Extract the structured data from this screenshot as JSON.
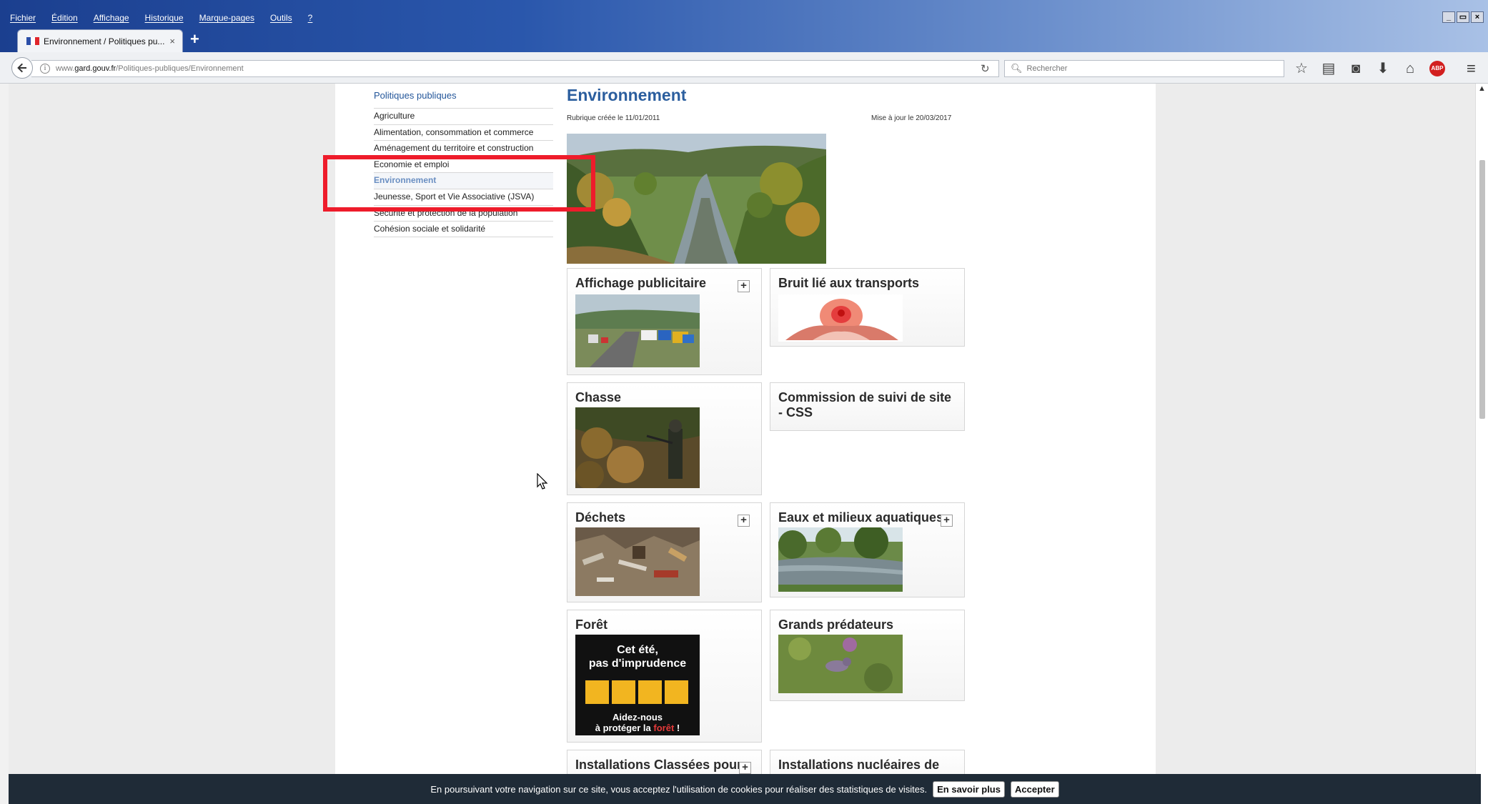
{
  "browser": {
    "menu": [
      "Fichier",
      "Édition",
      "Affichage",
      "Historique",
      "Marque-pages",
      "Outils",
      "?"
    ],
    "tab_title": "Environnement / Politiques pu...",
    "tab_close": "×",
    "new_tab": "+",
    "url_prefix": "www.",
    "url_domain": "gard.gouv.fr",
    "url_path": "/Politiques-publiques/Environnement",
    "search_placeholder": "Rechercher",
    "window_controls": [
      "_",
      "̅̅",
      "×"
    ]
  },
  "sidebar": {
    "heading": "Politiques publiques",
    "items": [
      "Agriculture",
      "Alimentation, consommation et commerce",
      "Aménagement du territoire et construction",
      "Economie et emploi",
      "Environnement",
      "Jeunesse, Sport et Vie Associative (JSVA)",
      "Sécurité et protection de la population",
      "Cohésion sociale et solidarité"
    ],
    "active_index": 4
  },
  "main": {
    "title": "Environnement",
    "created": "Rubrique créée le 11/01/2011",
    "updated": "Mise à jour le 20/03/2017",
    "cards": [
      {
        "title": "Affichage publicitaire",
        "plus": "+"
      },
      {
        "title": "Bruit lié aux transports"
      },
      {
        "title": "Chasse"
      },
      {
        "title": "Commission de suivi de site - CSS"
      },
      {
        "title": "Déchets",
        "plus": "+"
      },
      {
        "title": "Eaux et milieux aquatiques",
        "plus": "+"
      },
      {
        "title": "Forêt"
      },
      {
        "title": "Grands prédateurs"
      },
      {
        "title": "Installations Classées pour",
        "plus": "+"
      },
      {
        "title": "Installations nucléaires de"
      }
    ],
    "foret_poster": {
      "line1": "Cet été,",
      "line2": "pas d'imprudence",
      "line3": "Aidez-nous",
      "line4_a": "à protéger la",
      "line4_b": "forêt",
      "line4_c": " !"
    }
  },
  "cookie_banner": {
    "text": "En poursuivant votre navigation sur ce site, vous acceptez l'utilisation de cookies pour réaliser des statistiques de visites.",
    "more_label": "En savoir plus",
    "accept_label": "Accepter"
  },
  "colors": {
    "brand_blue": "#2b5e9e",
    "highlight_red": "#ee1c2b",
    "cookie_bg": "#1f2b37"
  },
  "icons": [
    "back-arrow-icon",
    "info-icon",
    "reload-icon",
    "search-icon",
    "star-icon",
    "reading-list-icon",
    "pocket-icon",
    "download-icon",
    "home-icon",
    "adblock-icon",
    "hamburger-menu-icon"
  ]
}
